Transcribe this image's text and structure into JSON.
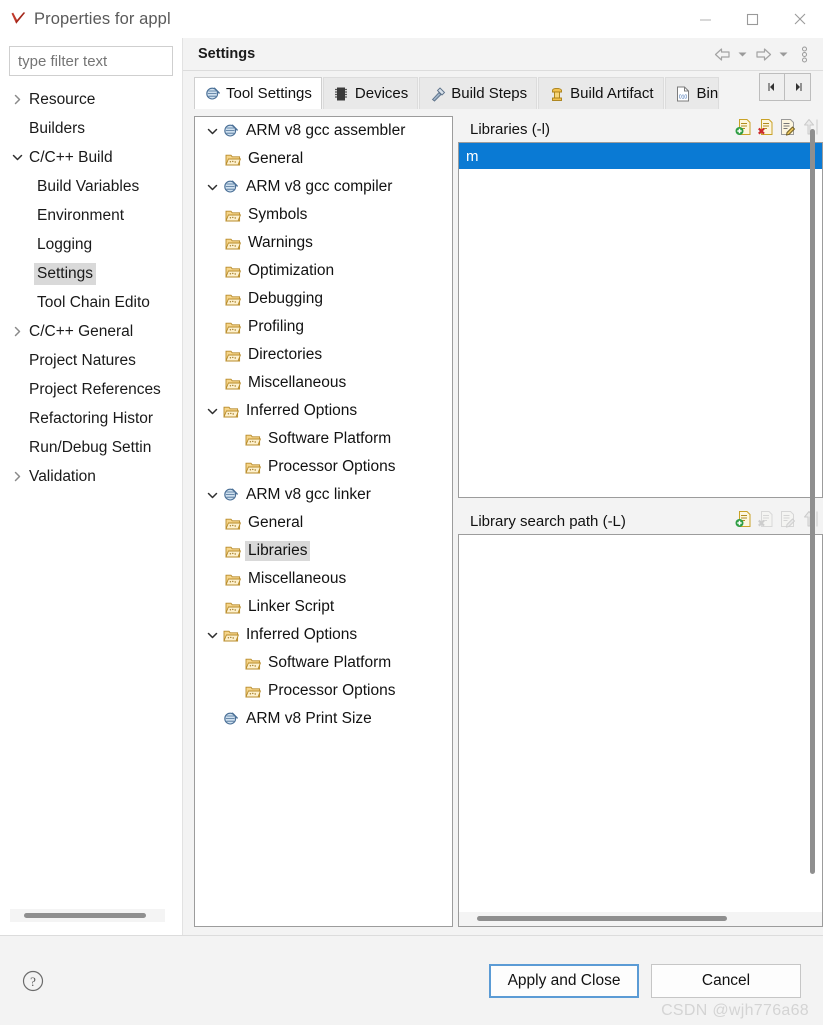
{
  "window": {
    "title": "Properties for appl",
    "icon": "red-checkmark-icon",
    "minimize_label": "—",
    "maximize_label": "☐",
    "close_label": "✕"
  },
  "filter": {
    "placeholder": "type filter text",
    "value": ""
  },
  "nav_tree": [
    {
      "label": "Resource",
      "twisty": "collapsed",
      "indent": 0,
      "selected": false
    },
    {
      "label": "Builders",
      "twisty": "none",
      "indent": 0,
      "selected": false
    },
    {
      "label": "C/C++ Build",
      "twisty": "expanded",
      "indent": 0,
      "selected": false
    },
    {
      "label": "Build Variables",
      "twisty": "none",
      "indent": 1,
      "selected": false
    },
    {
      "label": "Environment",
      "twisty": "none",
      "indent": 1,
      "selected": false
    },
    {
      "label": "Logging",
      "twisty": "none",
      "indent": 1,
      "selected": false
    },
    {
      "label": "Settings",
      "twisty": "none",
      "indent": 1,
      "selected": true
    },
    {
      "label": "Tool Chain Edito",
      "twisty": "none",
      "indent": 1,
      "selected": false
    },
    {
      "label": "C/C++ General",
      "twisty": "collapsed",
      "indent": 0,
      "selected": false
    },
    {
      "label": "Project Natures",
      "twisty": "none",
      "indent": 0,
      "selected": false
    },
    {
      "label": "Project References",
      "twisty": "none",
      "indent": 0,
      "selected": false
    },
    {
      "label": "Refactoring Histor",
      "twisty": "none",
      "indent": 0,
      "selected": false
    },
    {
      "label": "Run/Debug Settin",
      "twisty": "none",
      "indent": 0,
      "selected": false
    },
    {
      "label": "Validation",
      "twisty": "collapsed",
      "indent": 0,
      "selected": false
    }
  ],
  "page": {
    "title": "Settings",
    "header_tools": [
      {
        "name": "back-arrow-icon",
        "label": "⇦"
      },
      {
        "name": "back-dropdown-icon",
        "label": "▾"
      },
      {
        "name": "forward-arrow-icon",
        "label": "⇨"
      },
      {
        "name": "forward-dropdown-icon",
        "label": "▾"
      },
      {
        "name": "view-menu-icon",
        "label": "⋮"
      }
    ]
  },
  "tabs": [
    {
      "label": "Tool Settings",
      "icon": "tool-settings-icon",
      "active": true
    },
    {
      "label": "Devices",
      "icon": "devices-chip-icon",
      "active": false
    },
    {
      "label": "Build Steps",
      "icon": "build-steps-icon",
      "active": false
    },
    {
      "label": "Build Artifact",
      "icon": "build-artifact-icon",
      "active": false
    },
    {
      "label": "Bin",
      "icon": "binary-parser-icon",
      "active": false,
      "clipped": true
    }
  ],
  "tab_nav": {
    "prev_label": "◂",
    "next_label": "▸"
  },
  "option_tree": [
    {
      "label": "ARM v8 gcc assembler",
      "level": 0,
      "twisty": "expanded",
      "icon": "toolchain-icon",
      "selected": false
    },
    {
      "label": "General",
      "level": 1,
      "twisty": "none",
      "icon": "option-folder-icon",
      "selected": false
    },
    {
      "label": "ARM v8 gcc compiler",
      "level": 0,
      "twisty": "expanded",
      "icon": "toolchain-icon",
      "selected": false
    },
    {
      "label": "Symbols",
      "level": 1,
      "twisty": "none",
      "icon": "option-folder-icon",
      "selected": false
    },
    {
      "label": "Warnings",
      "level": 1,
      "twisty": "none",
      "icon": "option-folder-icon",
      "selected": false
    },
    {
      "label": "Optimization",
      "level": 1,
      "twisty": "none",
      "icon": "option-folder-icon",
      "selected": false
    },
    {
      "label": "Debugging",
      "level": 1,
      "twisty": "none",
      "icon": "option-folder-icon",
      "selected": false
    },
    {
      "label": "Profiling",
      "level": 1,
      "twisty": "none",
      "icon": "option-folder-icon",
      "selected": false
    },
    {
      "label": "Directories",
      "level": 1,
      "twisty": "none",
      "icon": "option-folder-icon",
      "selected": false
    },
    {
      "label": "Miscellaneous",
      "level": 1,
      "twisty": "none",
      "icon": "option-folder-icon",
      "selected": false
    },
    {
      "label": "Inferred Options",
      "level": 1,
      "twisty": "expanded",
      "icon": "option-folder-icon",
      "selected": false
    },
    {
      "label": "Software Platform",
      "level": 2,
      "twisty": "none",
      "icon": "option-folder-icon",
      "selected": false
    },
    {
      "label": "Processor Options",
      "level": 2,
      "twisty": "none",
      "icon": "option-folder-icon",
      "selected": false
    },
    {
      "label": "ARM v8 gcc linker",
      "level": 0,
      "twisty": "expanded",
      "icon": "toolchain-icon",
      "selected": false
    },
    {
      "label": "General",
      "level": 1,
      "twisty": "none",
      "icon": "option-folder-icon",
      "selected": false
    },
    {
      "label": "Libraries",
      "level": 1,
      "twisty": "none",
      "icon": "option-folder-icon",
      "selected": true
    },
    {
      "label": "Miscellaneous",
      "level": 1,
      "twisty": "none",
      "icon": "option-folder-icon",
      "selected": false
    },
    {
      "label": "Linker Script",
      "level": 1,
      "twisty": "none",
      "icon": "option-folder-icon",
      "selected": false
    },
    {
      "label": "Inferred Options",
      "level": 1,
      "twisty": "expanded",
      "icon": "option-folder-icon",
      "selected": false
    },
    {
      "label": "Software Platform",
      "level": 2,
      "twisty": "none",
      "icon": "option-folder-icon",
      "selected": false
    },
    {
      "label": "Processor Options",
      "level": 2,
      "twisty": "none",
      "icon": "option-folder-icon",
      "selected": false
    },
    {
      "label": "ARM v8 Print Size",
      "level": 0,
      "twisty": "none",
      "icon": "toolchain-icon",
      "selected": false
    }
  ],
  "libraries": {
    "header": "Libraries (-l)",
    "items": [
      {
        "value": "m",
        "selected": true
      }
    ],
    "tools": [
      {
        "name": "add-library-icon",
        "enabled": true
      },
      {
        "name": "delete-library-icon",
        "enabled": true
      },
      {
        "name": "edit-library-icon",
        "enabled": true
      },
      {
        "name": "move-up-icon",
        "enabled": false
      }
    ]
  },
  "library_search_path": {
    "header": "Library search path (-L)",
    "items": [],
    "tools": [
      {
        "name": "add-path-icon",
        "enabled": true
      },
      {
        "name": "delete-path-icon",
        "enabled": false
      },
      {
        "name": "edit-path-icon",
        "enabled": false
      },
      {
        "name": "move-up-icon",
        "enabled": false
      }
    ]
  },
  "footer": {
    "help_label": "?",
    "apply_label": "Apply and Close",
    "cancel_label": "Cancel",
    "watermark": "CSDN @wjh776a68"
  },
  "colors": {
    "selection_blue": "#0a7ad4",
    "tree_selection_gray": "#d9d9d9",
    "default_button_border": "#5b9bd5",
    "dialog_background": "#f3f3f3"
  }
}
